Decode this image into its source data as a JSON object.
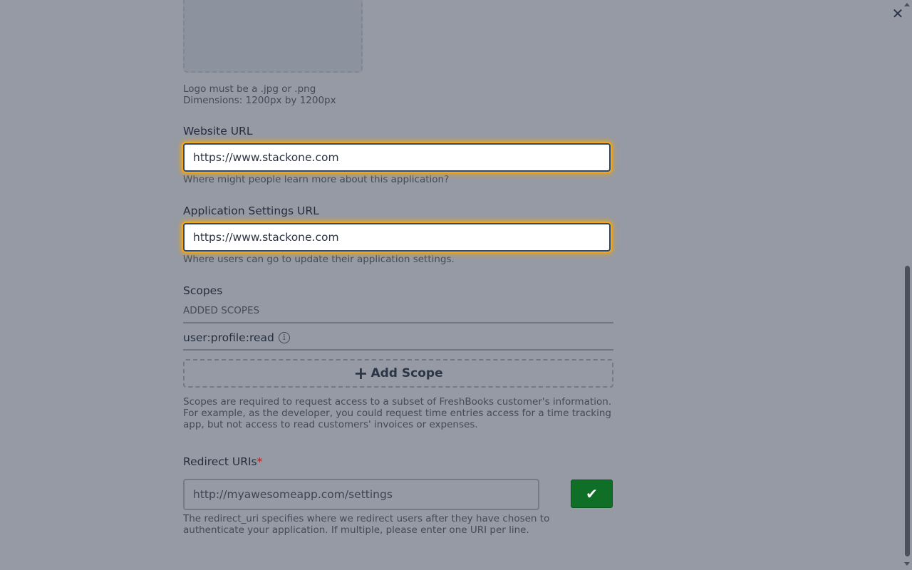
{
  "modal": {
    "close_icon": "close-icon"
  },
  "logo": {
    "hint_line1": "Logo must be a .jpg or .png",
    "hint_line2": "Dimensions: 1200px by 1200px"
  },
  "website_url": {
    "label": "Website URL",
    "value": "https://www.stackone.com",
    "hint": "Where might people learn more about this application?"
  },
  "settings_url": {
    "label": "Application Settings URL",
    "value": "https://www.stackone.com",
    "hint": "Where users can go to update their application settings."
  },
  "scopes": {
    "label": "Scopes",
    "added_header": "ADDED SCOPES",
    "items": [
      {
        "name": "user:profile:read",
        "icon": "info-icon"
      }
    ],
    "add_button": "Add Scope",
    "description": "Scopes are required to request access to a subset of FreshBooks customer's information. For example, as the developer, you could request time entries access for a time tracking app, but not access to read customers' invoices or expenses."
  },
  "redirect": {
    "label": "Redirect URIs",
    "required_mark": "*",
    "placeholder": "http://myawesomeapp.com/settings",
    "confirm_icon": "check-icon",
    "hint": "The redirect_uri specifies where we redirect users after they have chosen to authenticate your application. If multiple, please enter one URI per line."
  },
  "colors": {
    "overlay": "#959aa4",
    "focus_ring": "#f3a712",
    "confirm_button": "#0f6f26",
    "required": "#a8262a"
  }
}
